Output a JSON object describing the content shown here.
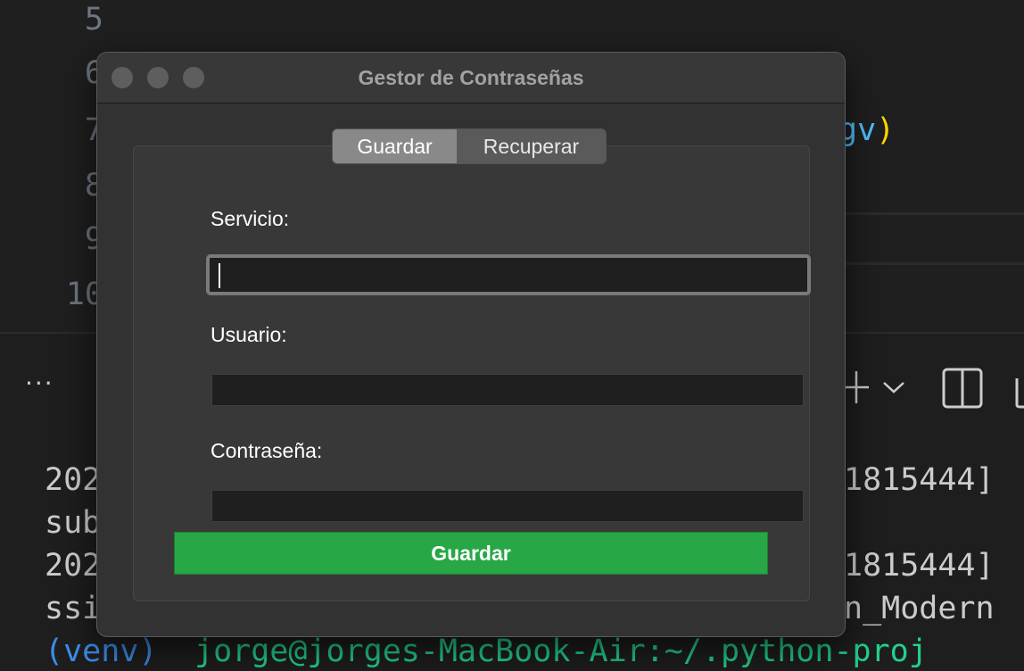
{
  "editor": {
    "line_numbers": [
      "5",
      "6",
      "7",
      "8",
      "9",
      "10"
    ],
    "code_fragment": "gv",
    "code_paren": ")"
  },
  "terminal": {
    "overflow_dots": "···",
    "lines_left": [
      "202",
      "sub",
      "202",
      "ssi"
    ],
    "lines_right": [
      "1815444]",
      "1815444]",
      "n_Modern"
    ],
    "prompt_venv": "(venv)",
    "prompt_user": "jorge@jorges-MacBook-Air:~/.python-proj"
  },
  "window": {
    "title": "Gestor de Contraseñas",
    "tabs": [
      {
        "label": "Guardar",
        "active": true
      },
      {
        "label": "Recuperar",
        "active": false
      }
    ],
    "fields": [
      {
        "label": "Servicio:",
        "value": "",
        "focused": true
      },
      {
        "label": "Usuario:",
        "value": "",
        "focused": false
      },
      {
        "label": "Contraseña:",
        "value": "",
        "focused": false
      }
    ],
    "save_label": "Guardar",
    "colors": {
      "save_button": "#27a745",
      "traffic_light": "#5e5e5e"
    }
  }
}
